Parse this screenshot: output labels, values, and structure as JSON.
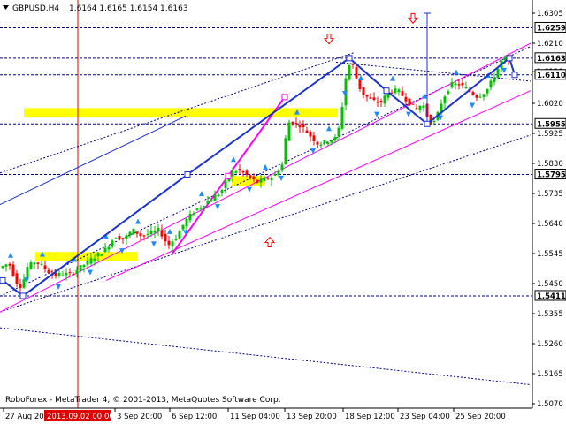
{
  "header": {
    "symbol": "GBPUSD,H4",
    "ohlc": "1.6164 1.6165 1.6154 1.6163"
  },
  "footer": {
    "copyright": "RoboForex - MetaTrader 4, © 2001-2013, MetaQuotes Software Corp."
  },
  "colors": {
    "bull_candle": "#00c000",
    "bear_candle": "#ff0000",
    "wave_line": "#1a33cc",
    "channel_line": "#ff00ff",
    "level_line": "#000080",
    "zone_fill": "#ffff00",
    "fractal_arrow": "#1e8cff",
    "vertical_marker": "#e00000"
  },
  "chart_data": {
    "type": "candlestick",
    "instrument": "GBPUSD",
    "timeframe": "H4",
    "ylim": [
      1.504,
      1.633
    ],
    "y_ticks": [
      "1.6305",
      "1.6210",
      "1.6120",
      "1.6020",
      "1.5925",
      "1.5830",
      "1.5735",
      "1.5640",
      "1.5545",
      "1.5450",
      "1.5355",
      "1.5260",
      "1.5165",
      "1.5070"
    ],
    "x_tick_labels": [
      "27 Aug 2013",
      "3 Sep 20:00",
      "6 Sep 12:00",
      "11 Sep 04:00",
      "13 Sep 20:00",
      "18 Sep 12:00",
      "23 Sep 04:00",
      "25 Sep 20:00"
    ],
    "cursor_time_label": "2013.09.02 00:00",
    "levels": [
      {
        "value": "1.6259",
        "y": 1.6259,
        "label_highlight": false
      },
      {
        "value": "1.6163",
        "y": 1.6163,
        "label_highlight": true
      },
      {
        "value": "1.6110",
        "y": 1.611,
        "label_highlight": false
      },
      {
        "value": "1.5955",
        "y": 1.5955,
        "label_highlight": false
      },
      {
        "value": "1.5795",
        "y": 1.5795,
        "label_highlight": false
      },
      {
        "value": "1.5411",
        "y": 1.5411,
        "label_highlight": false
      }
    ],
    "price_path": [
      [
        0,
        1.55
      ],
      [
        10,
        1.5515
      ],
      [
        20,
        1.5445
      ],
      [
        25,
        1.544
      ],
      [
        30,
        1.55
      ],
      [
        40,
        1.552
      ],
      [
        50,
        1.55
      ],
      [
        60,
        1.5475
      ],
      [
        70,
        1.548
      ],
      [
        80,
        1.548
      ],
      [
        90,
        1.55
      ],
      [
        100,
        1.552
      ],
      [
        110,
        1.554
      ],
      [
        120,
        1.556
      ],
      [
        130,
        1.56
      ],
      [
        140,
        1.559
      ],
      [
        150,
        1.562
      ],
      [
        160,
        1.56
      ],
      [
        170,
        1.561
      ],
      [
        180,
        1.562
      ],
      [
        190,
        1.557
      ],
      [
        200,
        1.56
      ],
      [
        210,
        1.565
      ],
      [
        220,
        1.568
      ],
      [
        230,
        1.57
      ],
      [
        240,
        1.572
      ],
      [
        250,
        1.574
      ],
      [
        260,
        1.58
      ],
      [
        270,
        1.581
      ],
      [
        280,
        1.579
      ],
      [
        290,
        1.577
      ],
      [
        300,
        1.578
      ],
      [
        310,
        1.579
      ],
      [
        320,
        1.583
      ],
      [
        325,
        1.596
      ],
      [
        330,
        1.596
      ],
      [
        340,
        1.595
      ],
      [
        350,
        1.592
      ],
      [
        360,
        1.589
      ],
      [
        370,
        1.59
      ],
      [
        380,
        1.591
      ],
      [
        385,
        1.596
      ],
      [
        390,
        1.609
      ],
      [
        397,
        1.616
      ],
      [
        405,
        1.608
      ],
      [
        410,
        1.605
      ],
      [
        420,
        1.603
      ],
      [
        430,
        1.602
      ],
      [
        440,
        1.606
      ],
      [
        450,
        1.606
      ],
      [
        460,
        1.603
      ],
      [
        470,
        1.6
      ],
      [
        478,
        1.602
      ],
      [
        485,
        1.5965
      ],
      [
        492,
        1.596
      ],
      [
        500,
        1.603
      ],
      [
        510,
        1.608
      ],
      [
        520,
        1.608
      ],
      [
        530,
        1.606
      ],
      [
        540,
        1.604
      ],
      [
        550,
        1.606
      ],
      [
        560,
        1.611
      ],
      [
        566,
        1.615
      ],
      [
        570,
        1.6163
      ],
      [
        575,
        1.615
      ]
    ],
    "wave_path": [
      [
        3,
        1.546
      ],
      [
        26,
        1.5411
      ],
      [
        212,
        1.5795
      ],
      [
        395,
        1.6163
      ],
      [
        437,
        1.606
      ],
      [
        483,
        1.5955
      ],
      [
        576,
        1.6163
      ],
      [
        582,
        1.611
      ]
    ],
    "channel_lines": [
      [
        0,
        1.536,
        600,
        1.621
      ],
      [
        120,
        1.546,
        600,
        1.606
      ],
      [
        195,
        1.5545,
        322,
        1.604
      ]
    ],
    "trend_lines": [
      [
        0,
        1.541,
        600,
        1.62
      ],
      [
        0,
        1.58,
        400,
        1.618
      ],
      [
        380,
        1.615,
        600,
        1.609
      ],
      [
        0,
        1.536,
        600,
        1.592
      ],
      [
        0,
        1.531,
        600,
        1.513
      ]
    ],
    "yellow_zones": [
      [
        27,
        382,
        1.5975,
        1.6005
      ],
      [
        40,
        155,
        1.552,
        1.555
      ],
      [
        262,
        300,
        1.576,
        1.579
      ]
    ],
    "vertical_marker_x": 88,
    "up_arrows": [
      [
        305,
        1.558
      ]
    ],
    "down_arrows": [
      [
        372,
        1.6225
      ],
      [
        467,
        1.629
      ]
    ],
    "target_bracket": [
      [
        483,
        1.5955
      ],
      [
        483,
        1.6305
      ]
    ]
  }
}
